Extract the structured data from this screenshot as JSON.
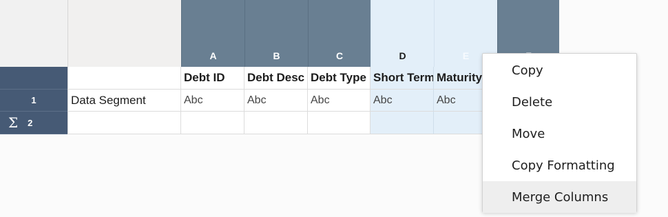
{
  "column_headers": [
    "A",
    "B",
    "C",
    "D",
    "E",
    "F"
  ],
  "hidden_columns_icon": "eye-slash-icon",
  "field_labels": [
    "Debt ID",
    "Debt Desc",
    "Debt Type",
    "Short Term",
    "Maturity"
  ],
  "rows": [
    {
      "number": "1",
      "name": "Data Segment",
      "values": [
        "Abc",
        "Abc",
        "Abc",
        "Abc",
        "Abc"
      ]
    },
    {
      "number": "2",
      "summary_icon": "Σ",
      "name": "",
      "values": [
        "",
        "",
        "",
        "",
        ""
      ]
    }
  ],
  "context_menu": {
    "items": [
      "Copy",
      "Delete",
      "Move",
      "Copy Formatting",
      "Merge Columns"
    ],
    "highlighted": "Merge Columns"
  },
  "colors": {
    "column_header": "#697f92",
    "selected_column": "#e3eff9",
    "row_header": "#465a75"
  }
}
